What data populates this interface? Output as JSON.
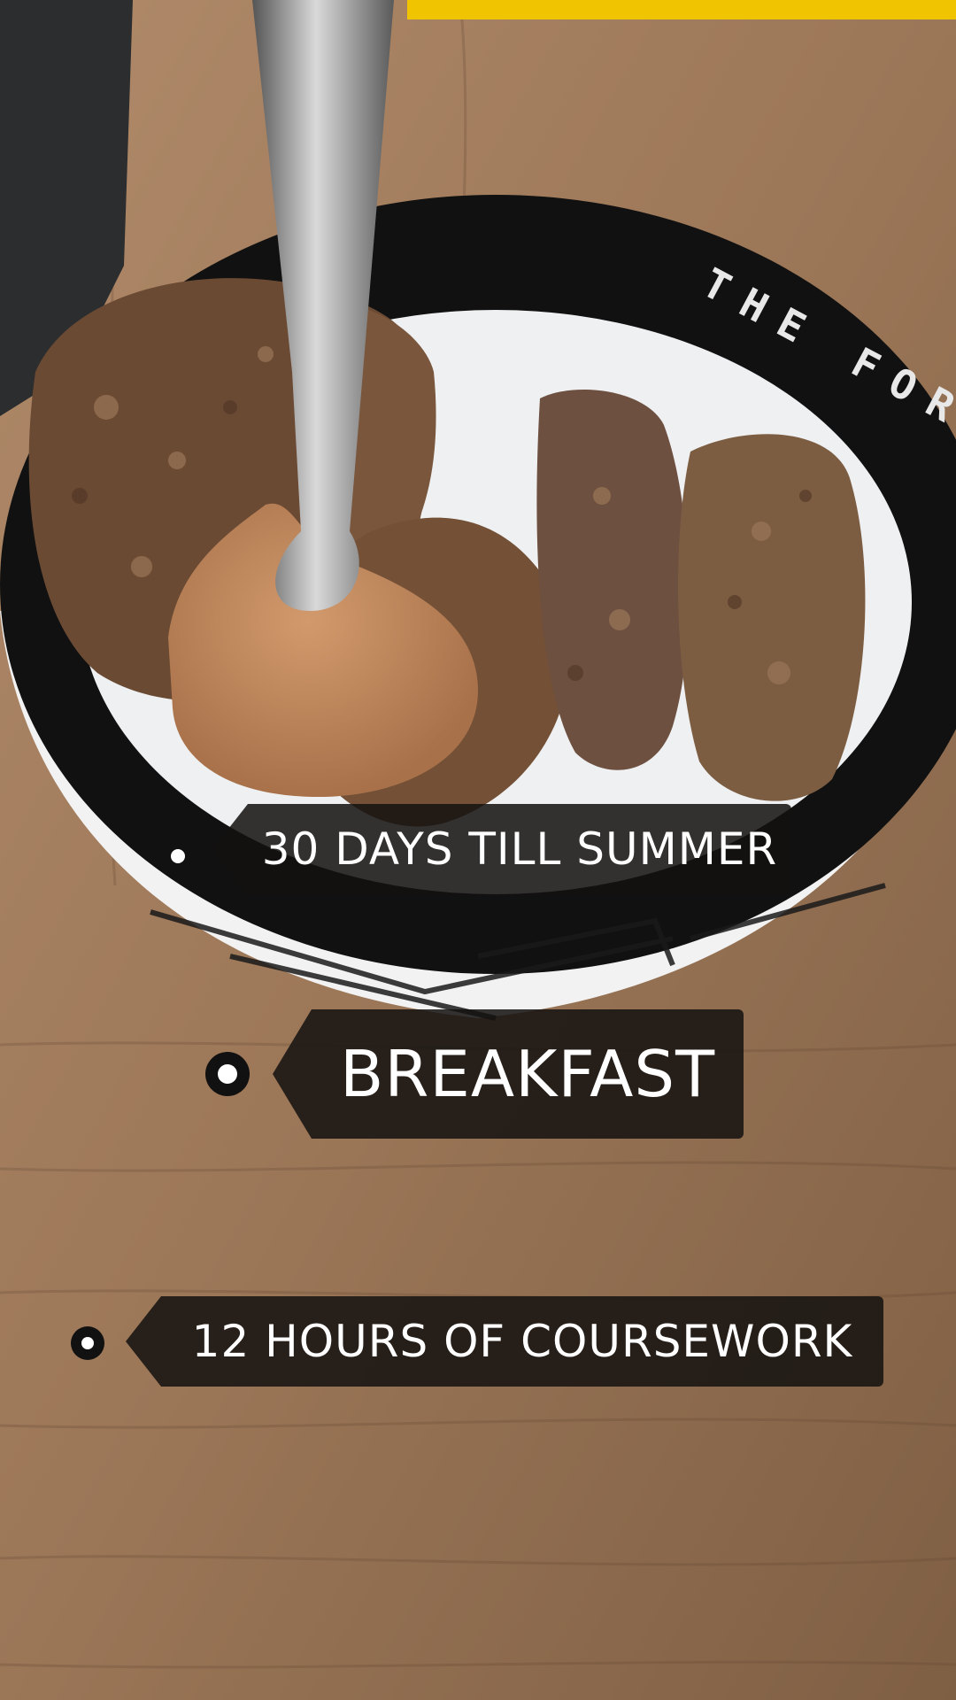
{
  "overlay_tags": [
    {
      "text": "30 DAYS TILL SUMMER"
    },
    {
      "text": "BREAKFAST"
    },
    {
      "text": "12 HOURS OF COURSEWORK"
    }
  ],
  "bowl_rim_text": "THE FORCE",
  "colors": {
    "table_wood": "#9b7657",
    "bowl_black": "#111111",
    "bowl_white": "#f2f2f2",
    "milk": "#eef0f2",
    "cereal": "#6b4a34",
    "peanut_butter": "#c18a5e",
    "tag_background": "#141210",
    "tag_text": "#ffffff",
    "yellow_box": "#f0c400"
  }
}
